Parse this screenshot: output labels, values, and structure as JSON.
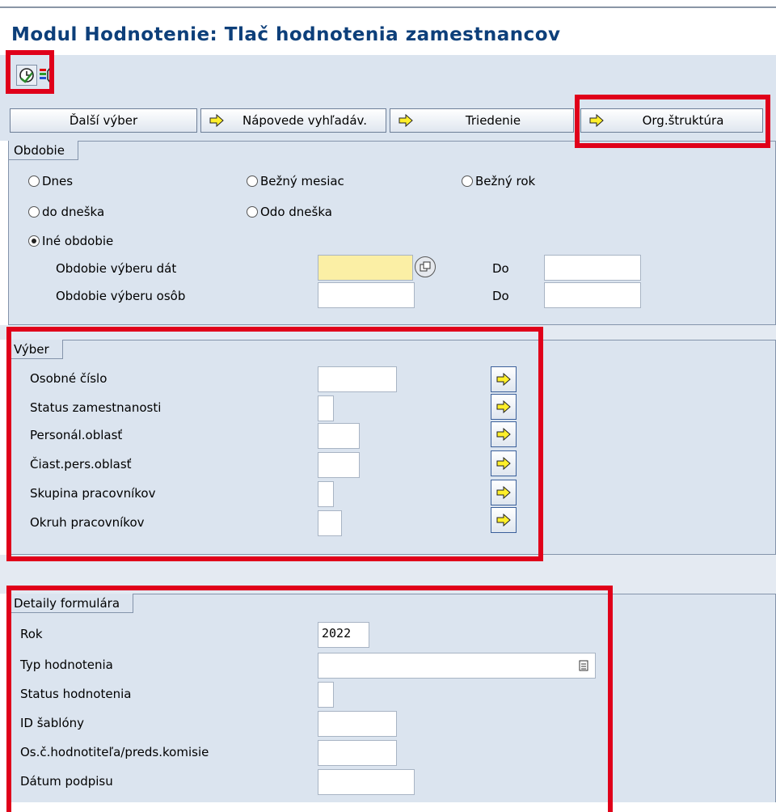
{
  "window": {
    "title": "Modul Hodnotenie: Tlač hodnotenia zamestnancov"
  },
  "toolbar": {
    "execute_icon": "execute-clock-icon",
    "variant_icon": "multicolor-selection-icon"
  },
  "buttons": {
    "dalsi_vyber": "Ďalší výber",
    "napovede": "Nápovede vyhľadáv.",
    "triedenie": "Triedenie",
    "org_struktura": "Org.štruktúra"
  },
  "obdobie": {
    "tab": "Obdobie",
    "radios": {
      "dnes": "Dnes",
      "bezny_mesiac": "Bežný mesiac",
      "bezny_rok": "Bežný rok",
      "do_dneska": "do dneška",
      "odo_dneska": "Odo dneška",
      "ine_obdobie": "Iné obdobie"
    },
    "selected": "ine_obdobie",
    "obdobie_vyberu_dat": {
      "label": "Obdobie výberu dát",
      "from": "",
      "to_label": "Do",
      "to": ""
    },
    "obdobie_vyberu_osob": {
      "label": "Obdobie výberu osôb",
      "from": "",
      "to_label": "Do",
      "to": ""
    }
  },
  "vyber": {
    "tab": "Výber",
    "fields": [
      {
        "label": "Osobné číslo",
        "value": ""
      },
      {
        "label": "Status zamestnanosti",
        "value": ""
      },
      {
        "label": "Personál.oblasť",
        "value": ""
      },
      {
        "label": "Čiast.pers.oblasť",
        "value": ""
      },
      {
        "label": "Skupina pracovníkov",
        "value": ""
      },
      {
        "label": "Okruh pracovníkov",
        "value": ""
      }
    ]
  },
  "detaily": {
    "tab": "Detaily formulára",
    "fields": [
      {
        "label": "Rok",
        "value": "2022"
      },
      {
        "label": "Typ hodnotenia",
        "value": ""
      },
      {
        "label": "Status hodnotenia",
        "value": ""
      },
      {
        "label": "ID šablóny",
        "value": ""
      },
      {
        "label": "Os.č.hodnotiteľa/preds.komisie",
        "value": ""
      },
      {
        "label": "Dátum podpisu",
        "value": ""
      }
    ]
  },
  "colors": {
    "highlight": "#e0001a",
    "panel": "#dbe4ef",
    "title": "#0d3f7a",
    "required": "#fbefa5"
  }
}
